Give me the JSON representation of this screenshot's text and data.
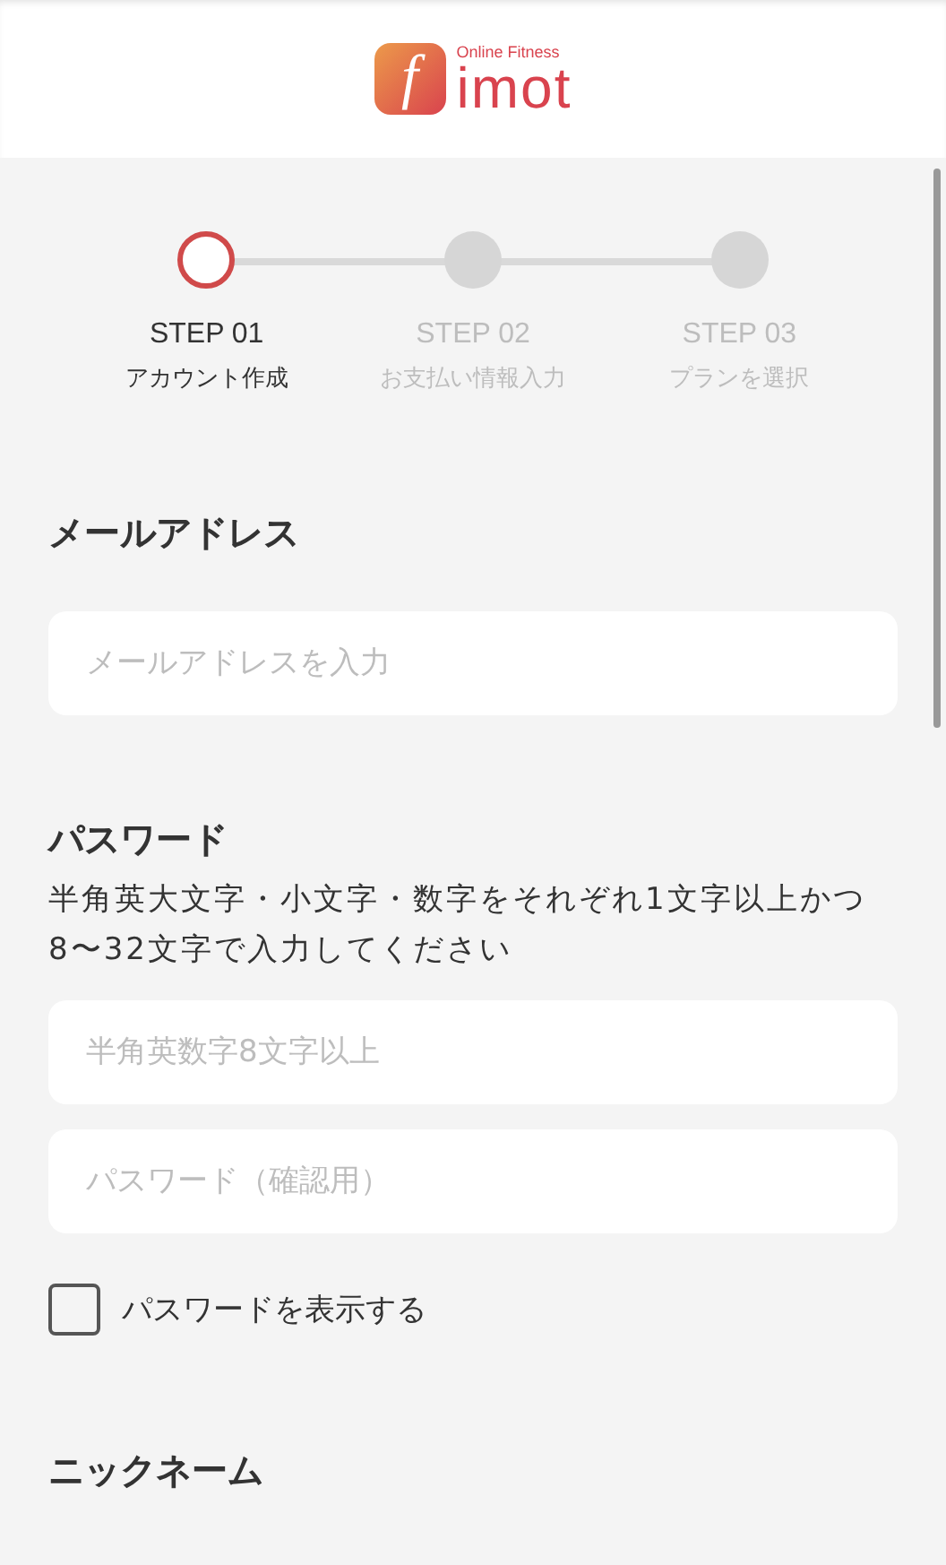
{
  "logo": {
    "mark": "f",
    "tagline": "Online Fitness",
    "name": "imot"
  },
  "steps": [
    {
      "label": "STEP 01",
      "caption": "アカウント作成",
      "selected": true
    },
    {
      "label": "STEP 02",
      "caption": "お支払い情報入力",
      "selected": false
    },
    {
      "label": "STEP 03",
      "caption": "プランを選択",
      "selected": false
    }
  ],
  "email": {
    "label": "メールアドレス",
    "placeholder": "メールアドレスを入力"
  },
  "password": {
    "label": "パスワード",
    "help": "半角英大文字・小文字・数字をそれぞれ1文字以上かつ8〜32文字で入力してください",
    "placeholder": "半角英数字8文字以上",
    "confirm_placeholder": "パスワード（確認用）"
  },
  "show_password": {
    "label": "パスワードを表示する",
    "checked": false
  },
  "nickname": {
    "label": "ニックネーム"
  }
}
